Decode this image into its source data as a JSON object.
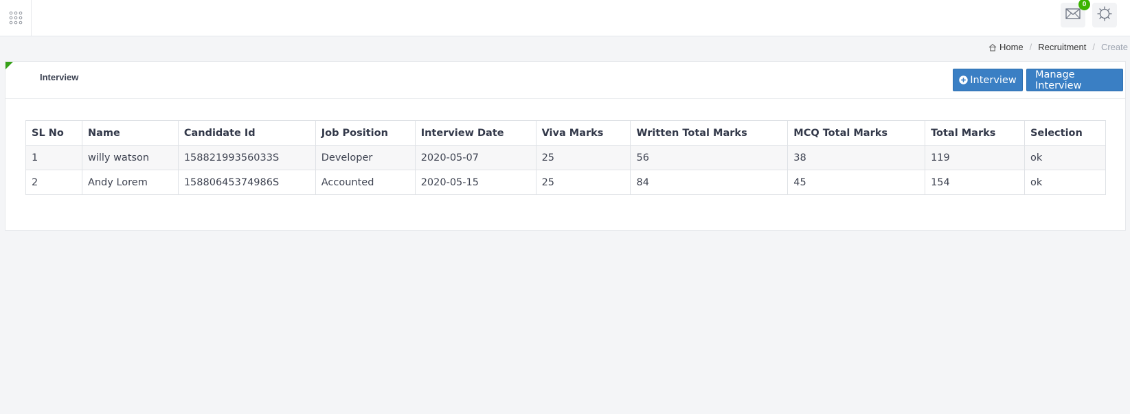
{
  "topbar": {
    "apps_icon": "grid-dots-icon",
    "mail_icon": "envelope-icon",
    "mail_badge": "0",
    "settings_icon": "gear-icon"
  },
  "breadcrumb": {
    "home_icon": "home-icon",
    "items": [
      "Home",
      "Recruitment",
      "Create"
    ]
  },
  "card": {
    "title": "Interview",
    "buttons": {
      "add_label": "Interview",
      "add_icon": "plus-circle-icon",
      "manage_label": "Manage Interview"
    }
  },
  "table": {
    "headers": [
      "SL No",
      "Name",
      "Candidate Id",
      "Job Position",
      "Interview Date",
      "Viva Marks",
      "Written Total Marks",
      "MCQ Total Marks",
      "Total Marks",
      "Selection"
    ],
    "rows": [
      [
        "1",
        "willy watson",
        "15882199356033S",
        "Developer",
        "2020-05-07",
        "25",
        "56",
        "38",
        "119",
        "ok"
      ],
      [
        "2",
        "Andy Lorem",
        "15880645374986S",
        "Accounted",
        "2020-05-15",
        "25",
        "84",
        "45",
        "154",
        "ok"
      ]
    ]
  },
  "colors": {
    "accent_blue": "#3a7fc4",
    "badge_green": "#3bb400",
    "corner_green": "#36a118",
    "background": "#f4f5f7"
  }
}
